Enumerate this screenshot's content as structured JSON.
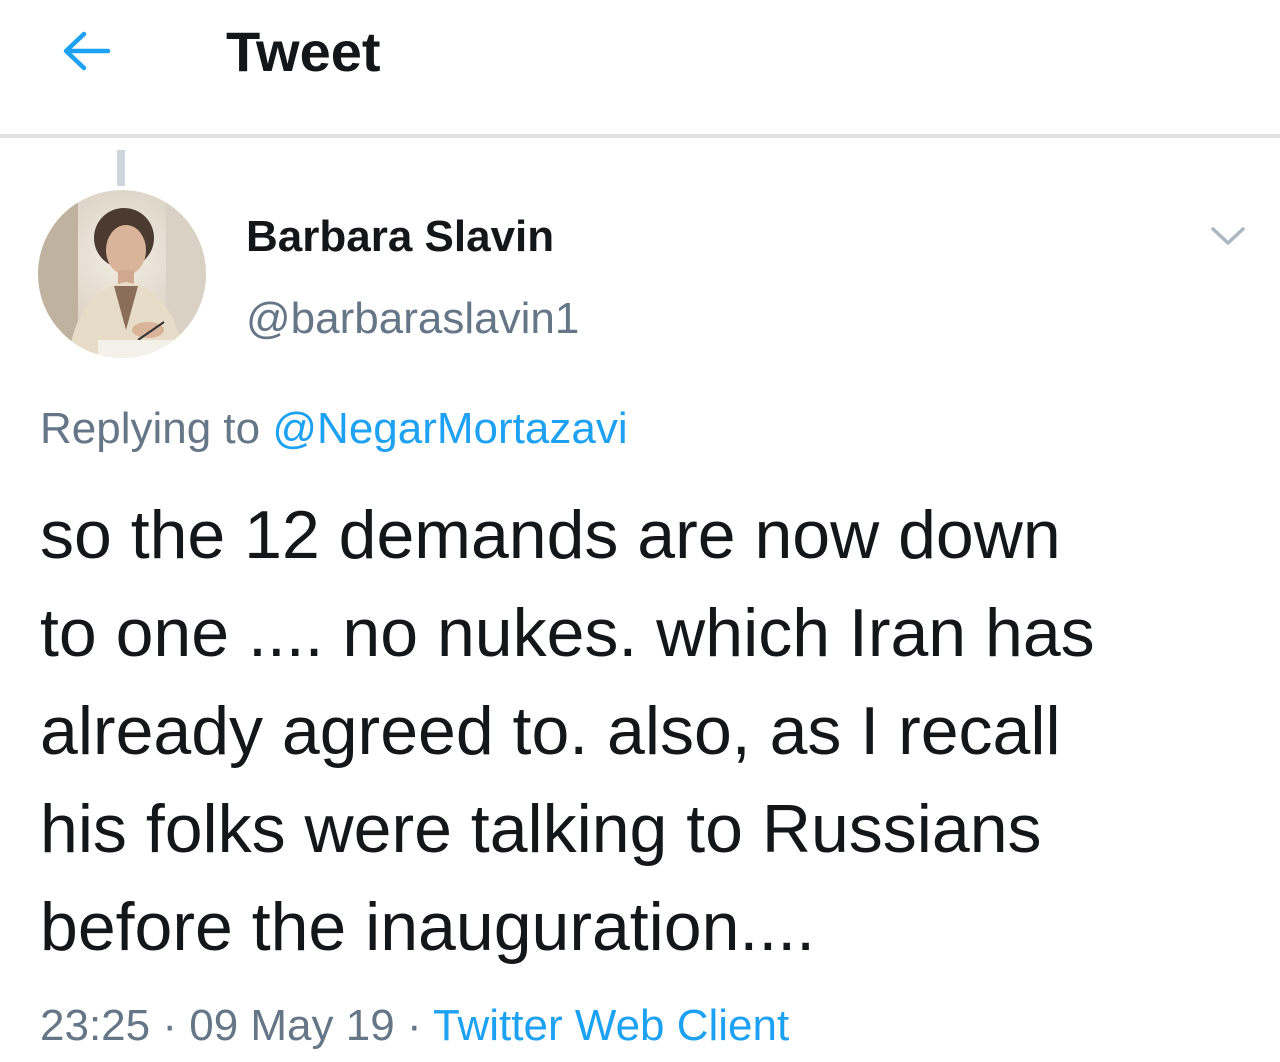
{
  "header": {
    "title": "Tweet",
    "back_icon": "arrow-left-icon",
    "accent_color": "#1da1f2"
  },
  "tweet": {
    "author": {
      "display_name": "Barbara Slavin",
      "handle": "@barbaraslavin1",
      "avatar_icon": "avatar-photo"
    },
    "menu_icon": "chevron-down-icon",
    "replying_label": "Replying to",
    "replying_to": "@NegarMortazavi",
    "text_lines": [
      "so the 12 demands are now down",
      "to one .... no nukes. which Iran has",
      "already agreed to. also, as I recall",
      "his folks were talking to Russians",
      "before the inauguration...."
    ],
    "time": "23:25",
    "date": "09 May 19",
    "separator": "·",
    "source": "Twitter Web Client"
  },
  "colors": {
    "text_primary": "#14171a",
    "text_secondary": "#657786",
    "link": "#1da1f2",
    "divider": "#dfe3e6"
  }
}
